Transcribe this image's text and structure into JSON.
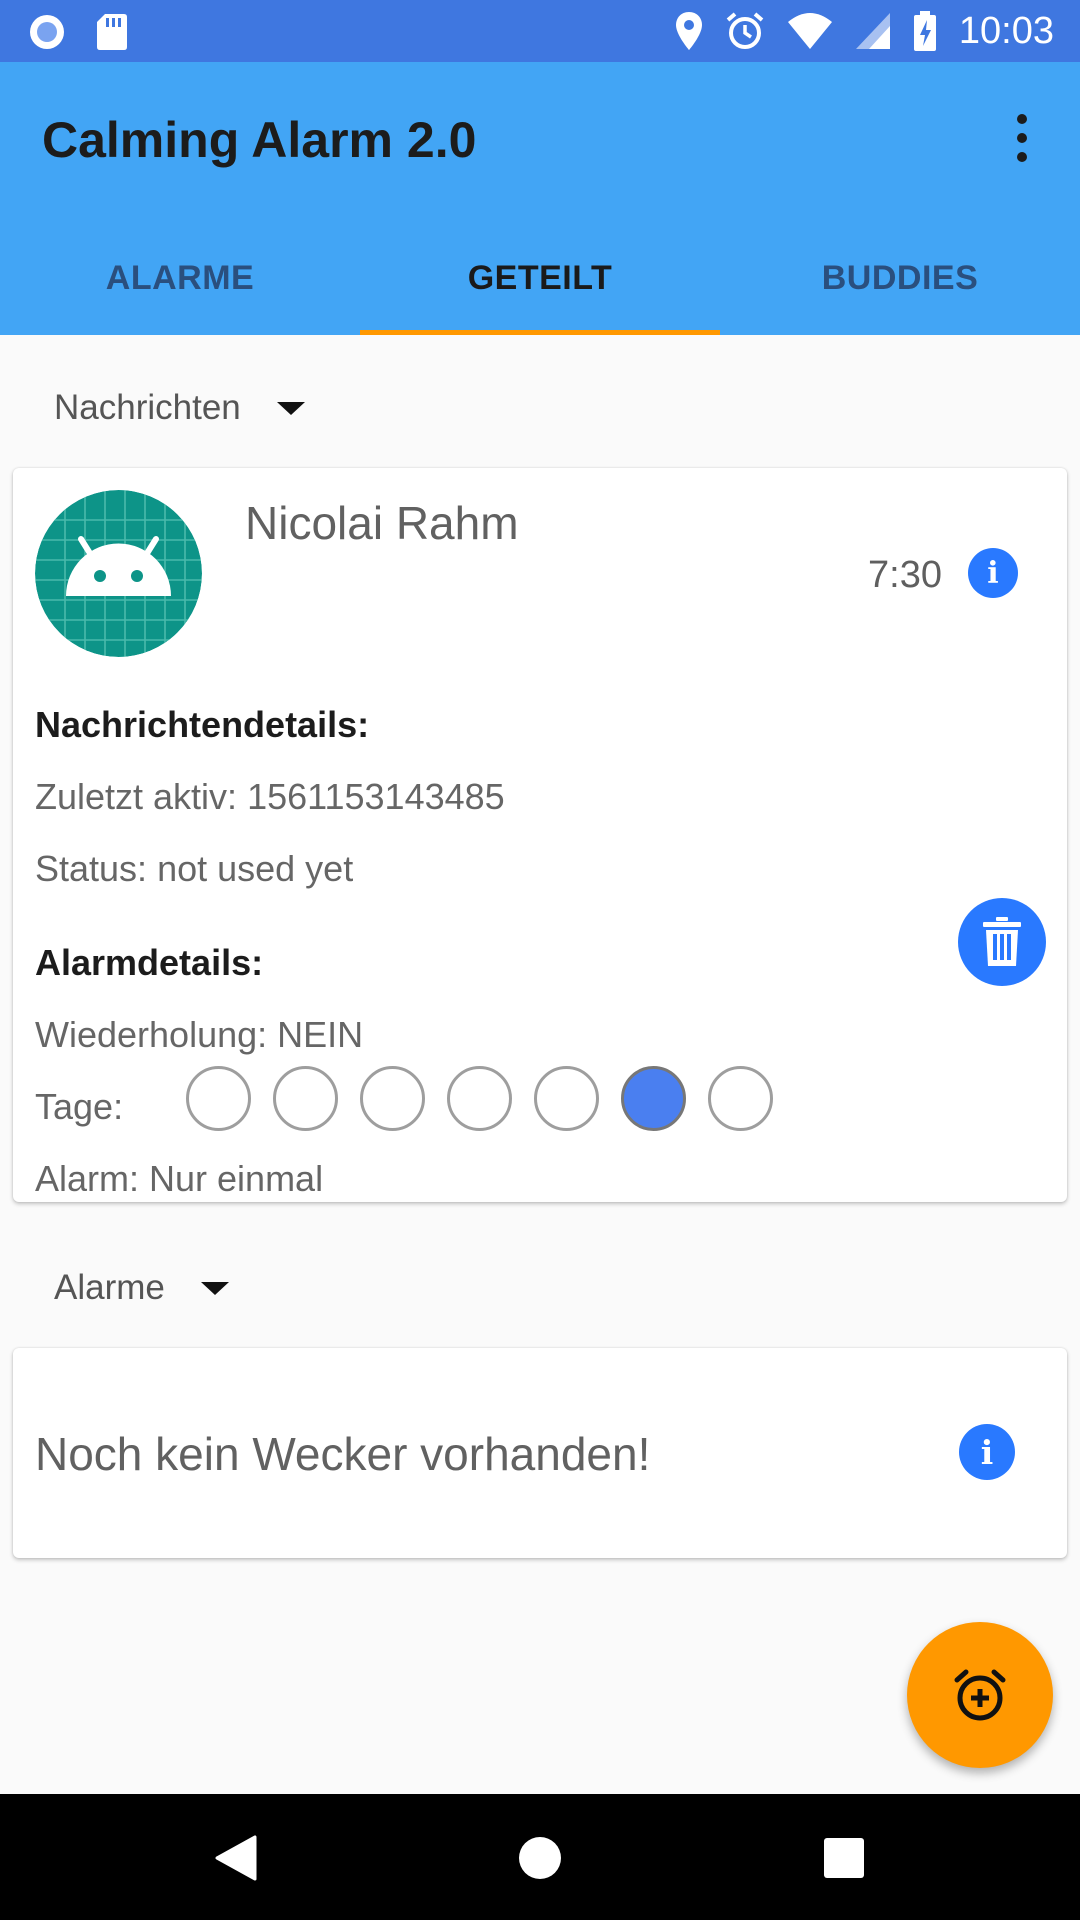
{
  "status_bar": {
    "time": "10:03",
    "left_icons": [
      "circle-notification-icon",
      "sd-card-icon"
    ],
    "right_icons": [
      "location-pin-icon",
      "alarm-clock-icon",
      "wifi-icon",
      "cell-signal-icon",
      "battery-charging-icon"
    ]
  },
  "app_bar": {
    "title": "Calming Alarm 2.0",
    "color": "#42a5f5",
    "overflow_icon": "more-vert-icon"
  },
  "tabs": [
    {
      "label": "ALARME",
      "active": false
    },
    {
      "label": "GETEILT",
      "active": true
    },
    {
      "label": "BUDDIES",
      "active": false
    }
  ],
  "tab_indicator_color": "#ff9800",
  "messages_section": {
    "label": "Nachrichten",
    "message": {
      "sender": "Nicolai Rahm",
      "avatar_icon": "android-icon",
      "time": "7:30",
      "details_heading": "Nachrichtendetails:",
      "last_active": "Zuletzt aktiv: 1561153143485",
      "status": "Status: not used yet",
      "alarm_heading": "Alarmdetails:",
      "repeat": "Wiederholung: NEIN",
      "days_label": "Tage:",
      "days_selected": [
        false,
        false,
        false,
        false,
        false,
        true,
        false
      ],
      "alarm_mode": "Alarm: Nur einmal"
    }
  },
  "alarms_section": {
    "label": "Alarme",
    "empty_text": "Noch kein Wecker vorhanden!"
  },
  "fab": {
    "icon": "add-alarm-icon",
    "color": "#ff9800"
  },
  "nav": {
    "icons": [
      "back-icon",
      "home-icon",
      "recents-icon"
    ]
  }
}
